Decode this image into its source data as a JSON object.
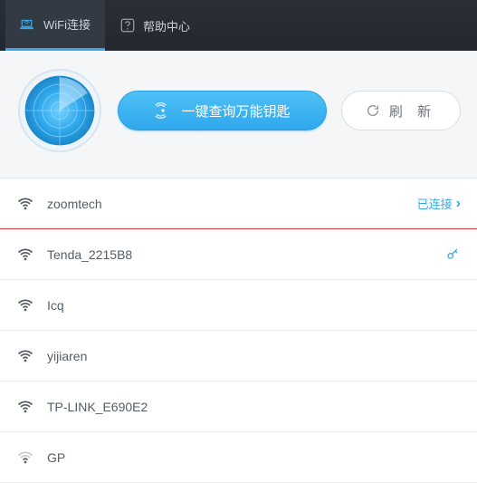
{
  "tabs": {
    "wifi_label": "WiFi连接",
    "help_label": "帮助中心"
  },
  "actions": {
    "query_label": "一键查询万能钥匙",
    "refresh_label": "刷 新"
  },
  "status": {
    "connected_label": "已连接"
  },
  "networks": [
    {
      "name": "zoomtech",
      "signal": "strong",
      "connected": true,
      "key": false
    },
    {
      "name": "Tenda_2215B8",
      "signal": "strong",
      "connected": false,
      "key": true
    },
    {
      "name": "Icq",
      "signal": "strong",
      "connected": false,
      "key": false
    },
    {
      "name": "yijiaren",
      "signal": "strong",
      "connected": false,
      "key": false
    },
    {
      "name": "TP-LINK_E690E2",
      "signal": "strong",
      "connected": false,
      "key": false
    },
    {
      "name": "GP",
      "signal": "weak",
      "connected": false,
      "key": false
    }
  ],
  "colors": {
    "accent": "#3ba8e6",
    "connected_underline": "#d93a3a"
  }
}
